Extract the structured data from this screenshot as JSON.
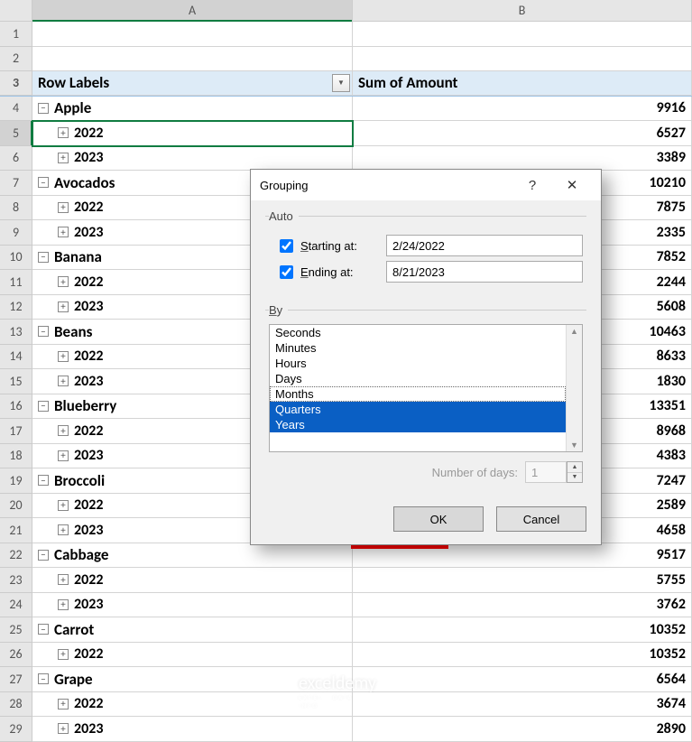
{
  "columns": [
    "A",
    "B"
  ],
  "pivot": {
    "header_label": "Row Labels",
    "header_value": "Sum of Amount",
    "rows": [
      {
        "n": 1,
        "type": "blank"
      },
      {
        "n": 2,
        "type": "blank"
      },
      {
        "n": 3,
        "type": "header"
      },
      {
        "n": 4,
        "type": "group",
        "label": "Apple",
        "value": "9916"
      },
      {
        "n": 5,
        "type": "sub",
        "label": "2022",
        "value": "6527",
        "selected": true
      },
      {
        "n": 6,
        "type": "sub",
        "label": "2023",
        "value": "3389"
      },
      {
        "n": 7,
        "type": "group",
        "label": "Avocados",
        "value": "10210"
      },
      {
        "n": 8,
        "type": "sub",
        "label": "2022",
        "value": "7875"
      },
      {
        "n": 9,
        "type": "sub",
        "label": "2023",
        "value": "2335"
      },
      {
        "n": 10,
        "type": "group",
        "label": "Banana",
        "value": "7852"
      },
      {
        "n": 11,
        "type": "sub",
        "label": "2022",
        "value": "2244"
      },
      {
        "n": 12,
        "type": "sub",
        "label": "2023",
        "value": "5608"
      },
      {
        "n": 13,
        "type": "group",
        "label": "Beans",
        "value": "10463"
      },
      {
        "n": 14,
        "type": "sub",
        "label": "2022",
        "value": "8633"
      },
      {
        "n": 15,
        "type": "sub",
        "label": "2023",
        "value": "1830"
      },
      {
        "n": 16,
        "type": "group",
        "label": "Blueberry",
        "value": "13351"
      },
      {
        "n": 17,
        "type": "sub",
        "label": "2022",
        "value": "8968"
      },
      {
        "n": 18,
        "type": "sub",
        "label": "2023",
        "value": "4383"
      },
      {
        "n": 19,
        "type": "group",
        "label": "Broccoli",
        "value": "7247"
      },
      {
        "n": 20,
        "type": "sub",
        "label": "2022",
        "value": "2589"
      },
      {
        "n": 21,
        "type": "sub",
        "label": "2023",
        "value": "4658"
      },
      {
        "n": 22,
        "type": "group",
        "label": "Cabbage",
        "value": "9517"
      },
      {
        "n": 23,
        "type": "sub",
        "label": "2022",
        "value": "5755"
      },
      {
        "n": 24,
        "type": "sub",
        "label": "2023",
        "value": "3762"
      },
      {
        "n": 25,
        "type": "group",
        "label": "Carrot",
        "value": "10352"
      },
      {
        "n": 26,
        "type": "sub",
        "label": "2022",
        "value": "10352"
      },
      {
        "n": 27,
        "type": "group",
        "label": "Grape",
        "value": "6564"
      },
      {
        "n": 28,
        "type": "sub",
        "label": "2022",
        "value": "3674"
      },
      {
        "n": 29,
        "type": "sub",
        "label": "2023",
        "value": "2890"
      }
    ]
  },
  "dialog": {
    "title": "Grouping",
    "auto_legend": "Auto",
    "start_label": "Starting at:",
    "start_value": "2/24/2022",
    "end_label": "Ending at:",
    "end_value": "8/21/2023",
    "by_legend": "By",
    "options": [
      {
        "label": "Seconds",
        "selected": false
      },
      {
        "label": "Minutes",
        "selected": false
      },
      {
        "label": "Hours",
        "selected": false
      },
      {
        "label": "Days",
        "selected": false
      },
      {
        "label": "Months",
        "selected": false,
        "dotted": true
      },
      {
        "label": "Quarters",
        "selected": true
      },
      {
        "label": "Years",
        "selected": true
      }
    ],
    "numdays_label": "Number of days:",
    "numdays_value": "1",
    "ok_label": "OK",
    "cancel_label": "Cancel"
  },
  "watermark": {
    "text": "exceldemy",
    "sub": "EXCEL · DATA · INFO"
  }
}
